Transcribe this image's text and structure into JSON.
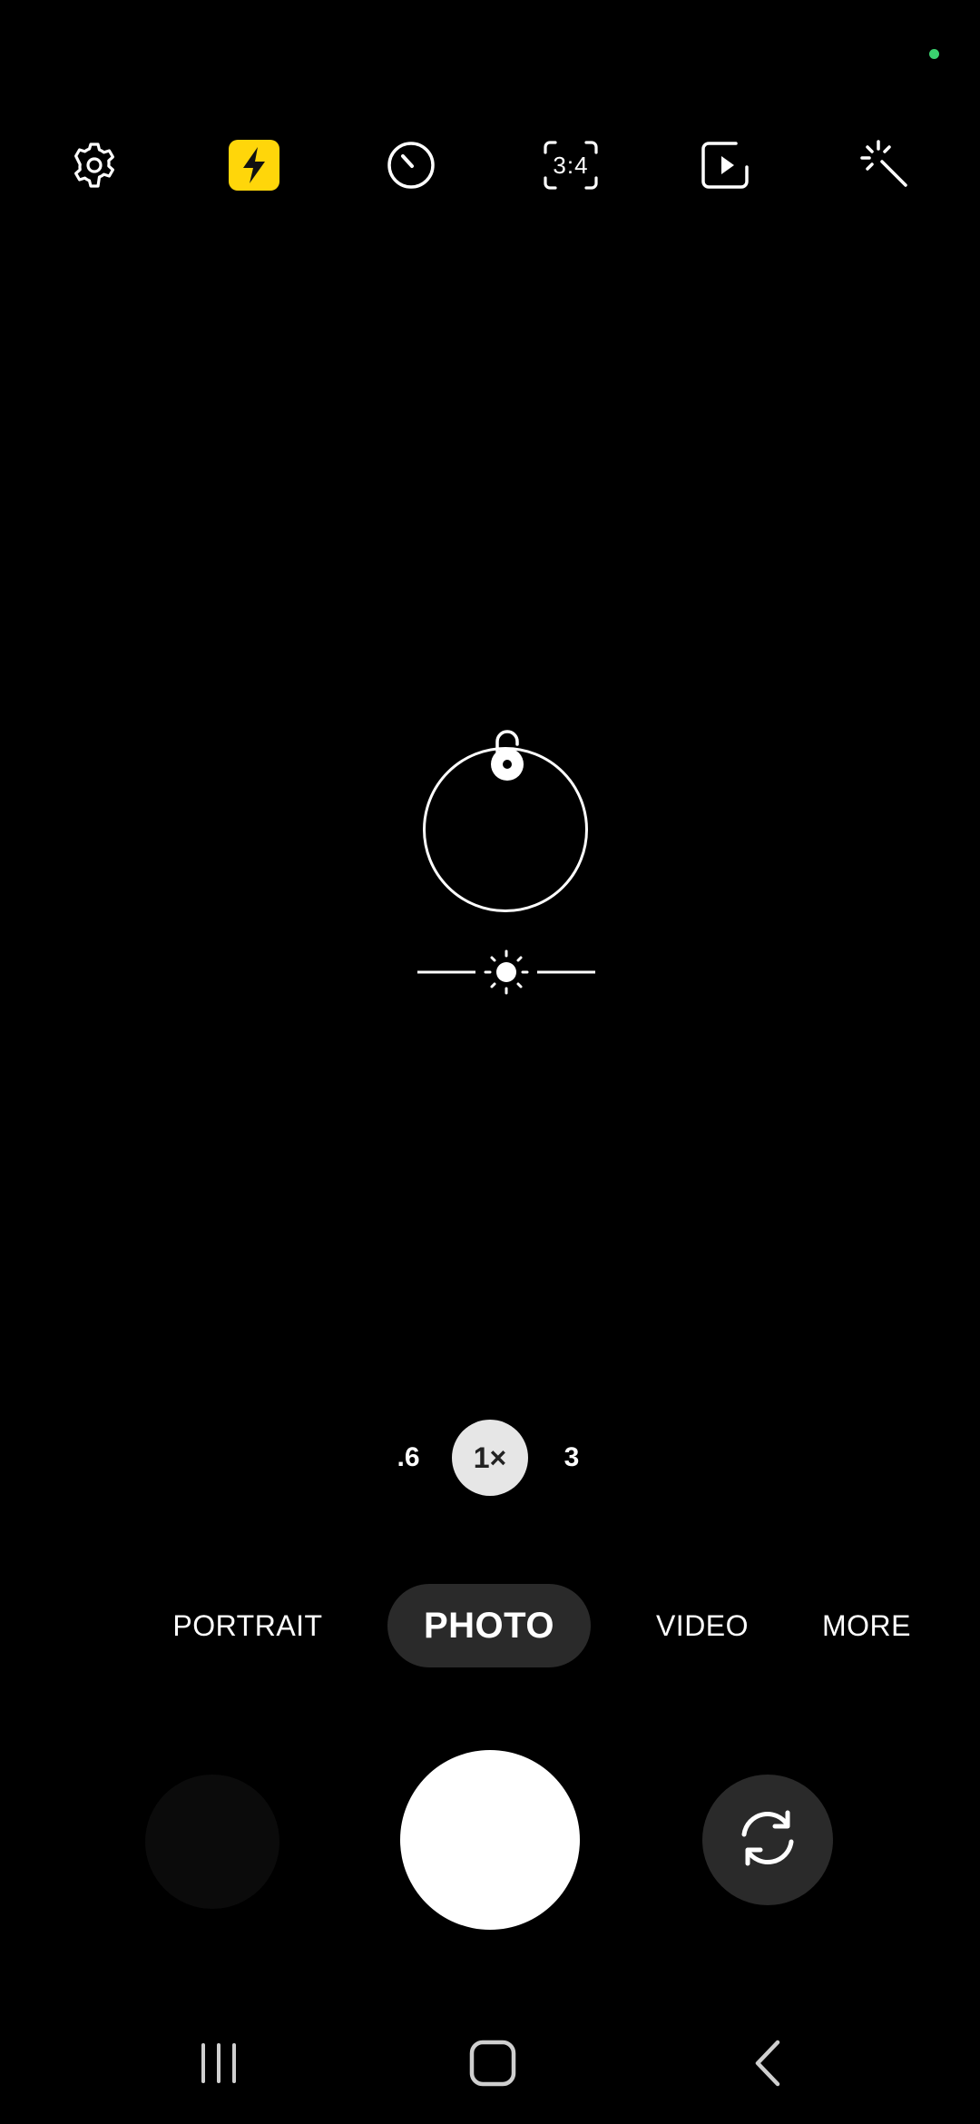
{
  "status": {
    "privacy_indicator_color": "#3bd16f"
  },
  "toolbar": {
    "items": [
      {
        "name": "settings",
        "icon": "gear-icon"
      },
      {
        "name": "flash",
        "icon": "flash-icon",
        "active": true,
        "color": "#ffd60a"
      },
      {
        "name": "timer",
        "icon": "timer-icon"
      },
      {
        "name": "aspect-ratio",
        "icon": "ratio-icon",
        "label": "3:4"
      },
      {
        "name": "motion-photo",
        "icon": "motion-photo-icon"
      },
      {
        "name": "filters",
        "icon": "magic-wand-icon"
      }
    ]
  },
  "focus": {
    "lock_icon": "unlock-icon",
    "exposure_icon": "sun-icon"
  },
  "zoom": {
    "options": [
      ".6",
      "1×",
      "3"
    ],
    "selected": "1×"
  },
  "modes": {
    "items": [
      "PORTRAIT",
      "PHOTO",
      "VIDEO",
      "MORE"
    ],
    "selected": "PHOTO"
  },
  "controls": {
    "shutter_icon": "shutter-button",
    "switch_icon": "switch-camera-icon"
  },
  "navbar": {
    "items": [
      {
        "name": "recent-apps",
        "icon": "recent-apps-icon"
      },
      {
        "name": "home",
        "icon": "home-icon"
      },
      {
        "name": "back",
        "icon": "back-icon"
      }
    ]
  }
}
